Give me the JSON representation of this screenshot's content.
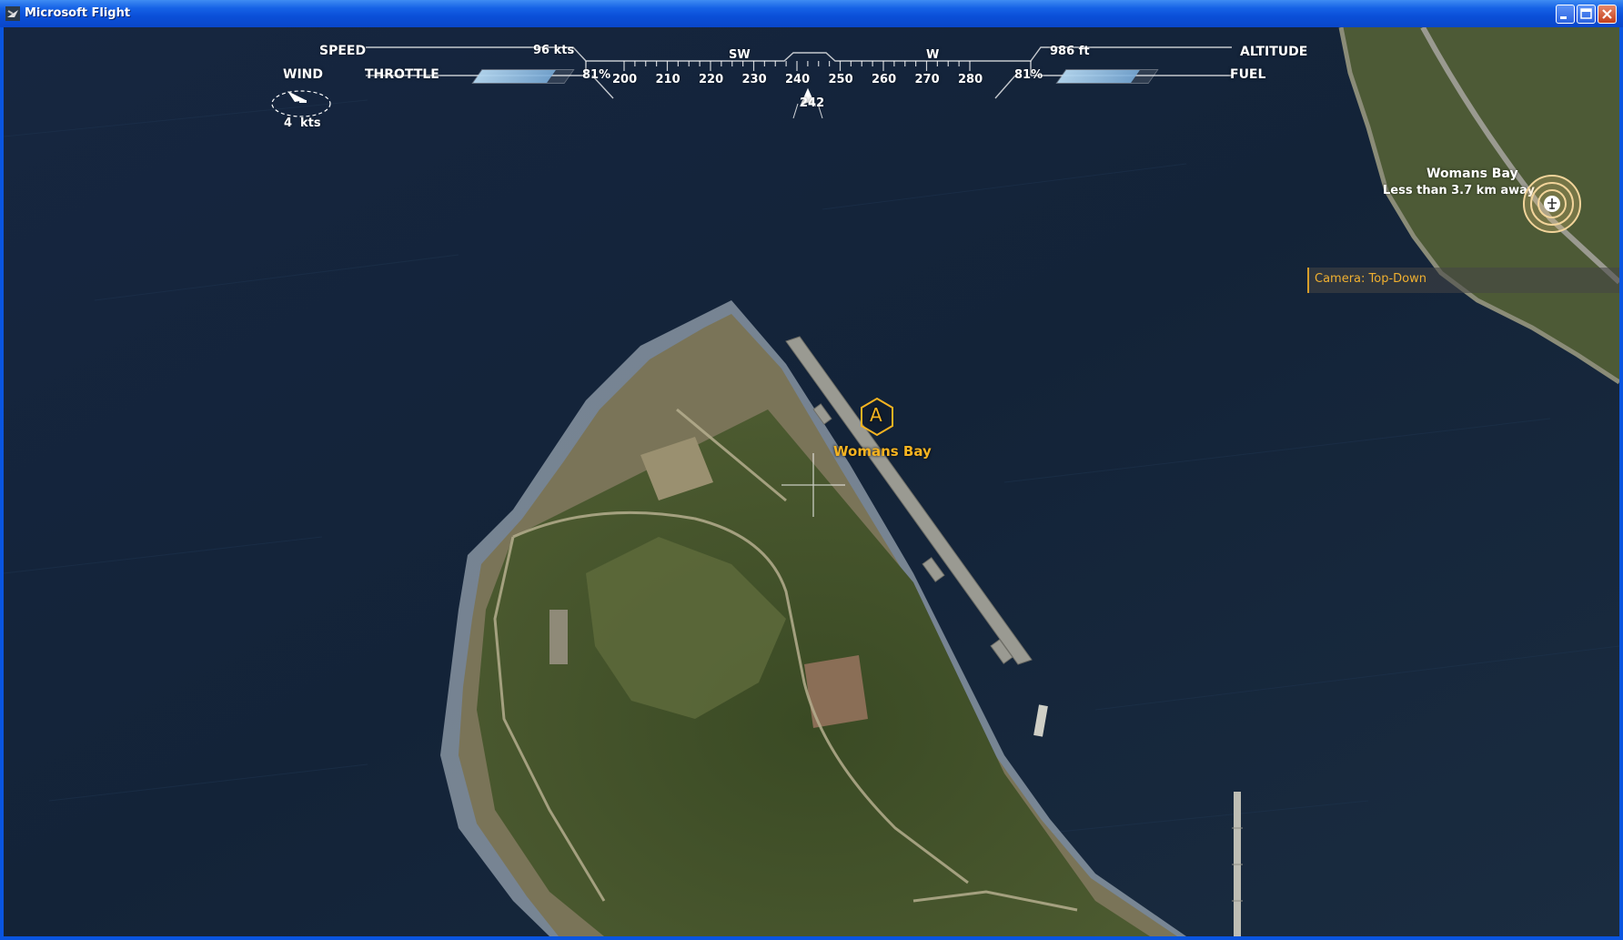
{
  "window": {
    "title": "Microsoft Flight",
    "buttons": {
      "minimize": "minimize-icon",
      "maximize": "maximize-icon",
      "close": "close-icon"
    }
  },
  "hud": {
    "speed_label": "SPEED",
    "speed_value": "96 kts",
    "altitude_label": "ALTITUDE",
    "altitude_value": "986 ft",
    "throttle_label": "THROTTLE",
    "throttle_value": "81%",
    "throttle_fraction": 0.81,
    "fuel_label": "FUEL",
    "fuel_value": "81%",
    "fuel_fraction": 0.81,
    "wind_label": "WIND",
    "wind_value": "4",
    "wind_unit": "kts",
    "heading_value": "242",
    "compass": {
      "cardinals": [
        "SW",
        "W"
      ],
      "ticks": [
        "200",
        "210",
        "220",
        "230",
        "240",
        "250",
        "260",
        "270",
        "280"
      ]
    }
  },
  "destination": {
    "name": "Womans Bay",
    "distance": "Less than 3.7 km away",
    "icon": "airport-target-icon"
  },
  "camera": {
    "label": "Camera: Top-Down"
  },
  "waypoint": {
    "letter": "A",
    "name": "Womans Bay",
    "icon": "waypoint-hexagon-icon"
  },
  "colors": {
    "accent": "#f5b321",
    "hud": "#ffffff",
    "water": "#13233a",
    "titlebar": "#0a55e0"
  }
}
